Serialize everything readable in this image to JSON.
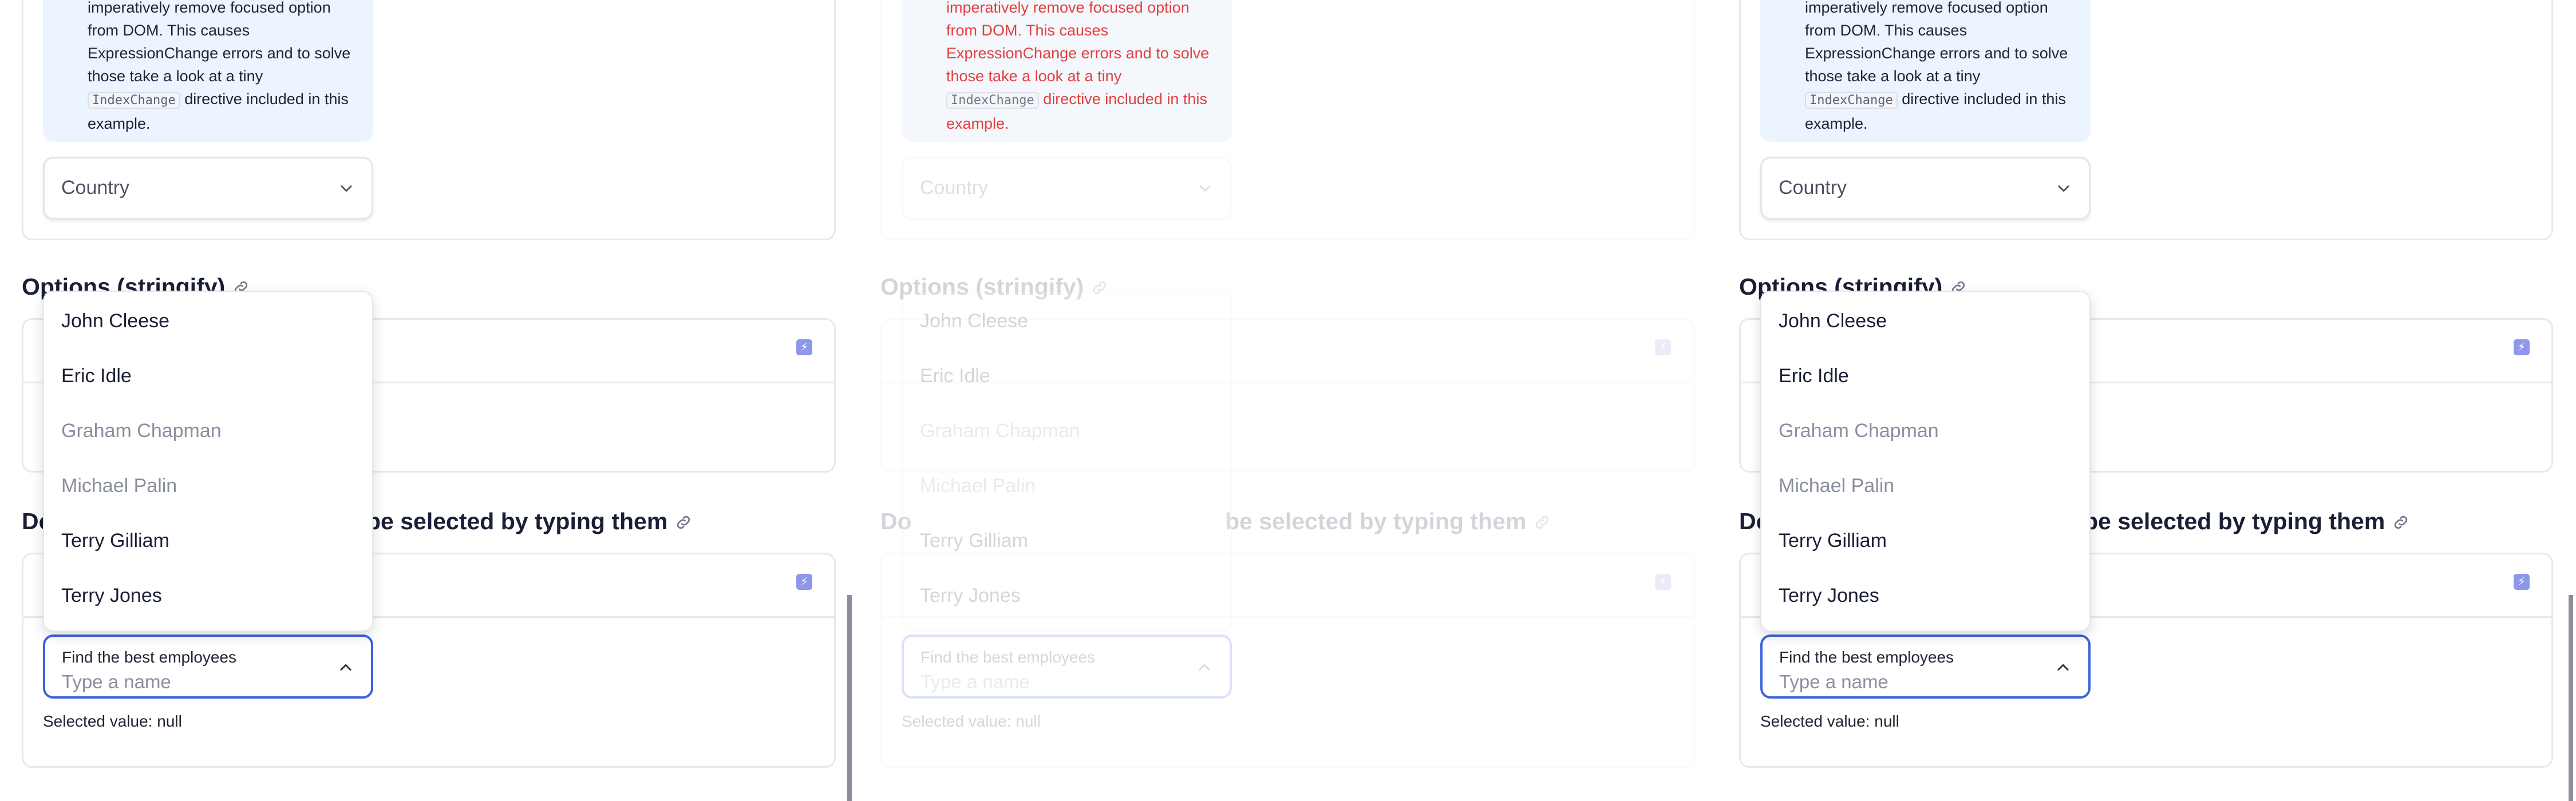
{
  "note": {
    "text_line0": "imperatively remove focused option",
    "text_rest": "from DOM. This causes ExpressionChange errors and to solve those take a look at a tiny",
    "code": "IndexChange",
    "text_after": "directive included in this example."
  },
  "country_select": {
    "value": "Country"
  },
  "sections": {
    "stringify_title": "Options (stringify)",
    "disabled_title_end": "be selected by typing them",
    "disabled_title_start": "Do"
  },
  "dropdown": {
    "options": [
      {
        "label": "John Cleese",
        "disabled": false
      },
      {
        "label": "Eric Idle",
        "disabled": false
      },
      {
        "label": "Graham Chapman",
        "disabled": true
      },
      {
        "label": "Michael Palin",
        "disabled": true
      },
      {
        "label": "Terry Gilliam",
        "disabled": false
      },
      {
        "label": "Terry Jones",
        "disabled": false
      }
    ]
  },
  "combo": {
    "label": "Find the best employees",
    "placeholder": "Type a name"
  },
  "selected_value_text": "Selected value: null",
  "icons": {
    "chevron_down": "chevron-down-icon",
    "chevron_up": "chevron-up-icon",
    "link": "link-icon",
    "flash": "flash-icon"
  },
  "colors": {
    "accent": "#3d63dd",
    "note_bg": "#ebf4ff",
    "flash_bg": "#8f97ea",
    "disabled_text": "#8a8fa0",
    "error_text": "#e02020"
  }
}
